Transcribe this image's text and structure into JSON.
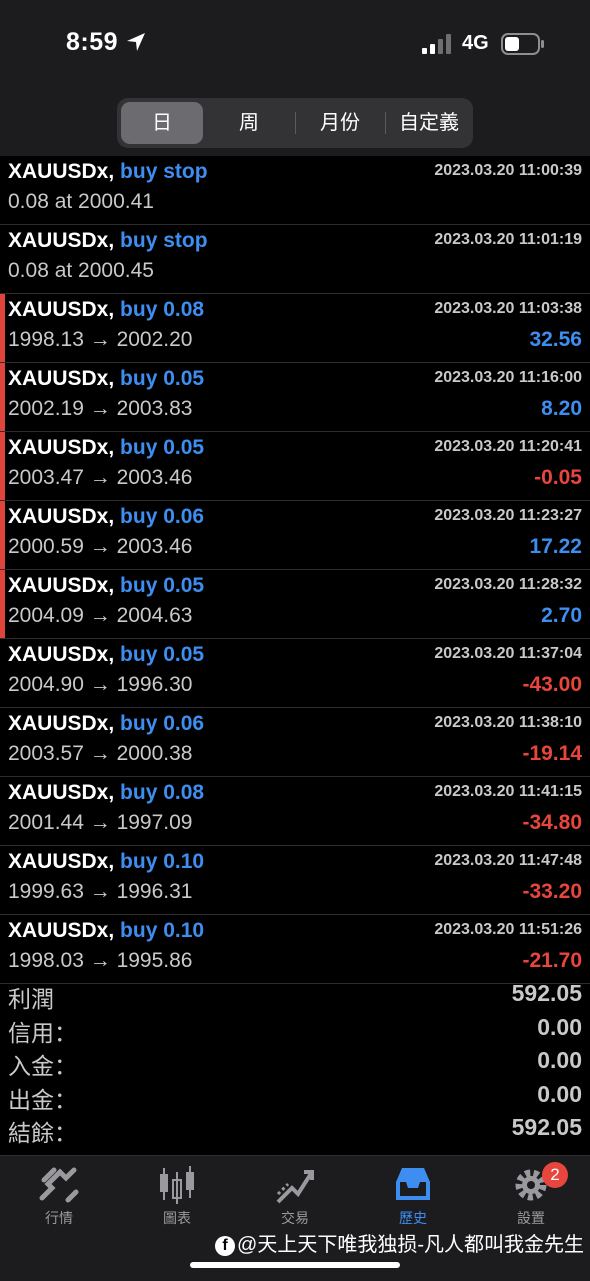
{
  "status": {
    "time": "8:59",
    "network": "4G"
  },
  "segments": [
    {
      "label": "日",
      "active": true
    },
    {
      "label": "周",
      "active": false
    },
    {
      "label": "月份",
      "active": false
    },
    {
      "label": "自定義",
      "active": false
    }
  ],
  "rows": [
    {
      "symbol": "XAUUSDx,",
      "action": "buy stop",
      "prices": "0.08 at 2000.41",
      "time": "2023.03.20 11:00:39",
      "pnl": "",
      "bar": false
    },
    {
      "symbol": "XAUUSDx,",
      "action": "buy stop",
      "prices": "0.08 at 2000.45",
      "time": "2023.03.20 11:01:19",
      "pnl": "",
      "bar": false
    },
    {
      "symbol": "XAUUSDx,",
      "action": "buy 0.08",
      "prices": "1998.13 → 2002.20",
      "time": "2023.03.20 11:03:38",
      "pnl": "32.56",
      "bar": true
    },
    {
      "symbol": "XAUUSDx,",
      "action": "buy 0.05",
      "prices": "2002.19 → 2003.83",
      "time": "2023.03.20 11:16:00",
      "pnl": "8.20",
      "bar": true
    },
    {
      "symbol": "XAUUSDx,",
      "action": "buy 0.05",
      "prices": "2003.47 → 2003.46",
      "time": "2023.03.20 11:20:41",
      "pnl": "-0.05",
      "bar": true
    },
    {
      "symbol": "XAUUSDx,",
      "action": "buy 0.06",
      "prices": "2000.59 → 2003.46",
      "time": "2023.03.20 11:23:27",
      "pnl": "17.22",
      "bar": true
    },
    {
      "symbol": "XAUUSDx,",
      "action": "buy 0.05",
      "prices": "2004.09 → 2004.63",
      "time": "2023.03.20 11:28:32",
      "pnl": "2.70",
      "bar": true
    },
    {
      "symbol": "XAUUSDx,",
      "action": "buy 0.05",
      "prices": "2004.90 → 1996.30",
      "time": "2023.03.20 11:37:04",
      "pnl": "-43.00",
      "bar": false
    },
    {
      "symbol": "XAUUSDx,",
      "action": "buy 0.06",
      "prices": "2003.57 → 2000.38",
      "time": "2023.03.20 11:38:10",
      "pnl": "-19.14",
      "bar": false
    },
    {
      "symbol": "XAUUSDx,",
      "action": "buy 0.08",
      "prices": "2001.44 → 1997.09",
      "time": "2023.03.20 11:41:15",
      "pnl": "-34.80",
      "bar": false
    },
    {
      "symbol": "XAUUSDx,",
      "action": "buy 0.10",
      "prices": "1999.63 → 1996.31",
      "time": "2023.03.20 11:47:48",
      "pnl": "-33.20",
      "bar": false
    },
    {
      "symbol": "XAUUSDx,",
      "action": "buy 0.10",
      "prices": "1998.03 → 1995.86",
      "time": "2023.03.20 11:51:26",
      "pnl": "-21.70",
      "bar": false
    }
  ],
  "summary": [
    {
      "label": "利潤",
      "value": "592.05"
    },
    {
      "label": "信用：",
      "value": "0.00"
    },
    {
      "label": "入金：",
      "value": "0.00"
    },
    {
      "label": "出金：",
      "value": "0.00"
    },
    {
      "label": "結餘：",
      "value": "592.05"
    }
  ],
  "tabs": [
    {
      "label": "行情",
      "icon": "quotes-icon",
      "active": false
    },
    {
      "label": "圖表",
      "icon": "chart-icon",
      "active": false
    },
    {
      "label": "交易",
      "icon": "trade-icon",
      "active": false
    },
    {
      "label": "歷史",
      "icon": "history-icon",
      "active": true
    },
    {
      "label": "設置",
      "icon": "settings-icon",
      "active": false,
      "badge": "2"
    }
  ],
  "watermark": {
    "text": "@天上天下唯我独损-凡人都叫我金先生"
  },
  "colors": {
    "accent": "#3d8ef0",
    "negative": "#e8453c",
    "background": "#000000",
    "bar": "#e0443a"
  }
}
